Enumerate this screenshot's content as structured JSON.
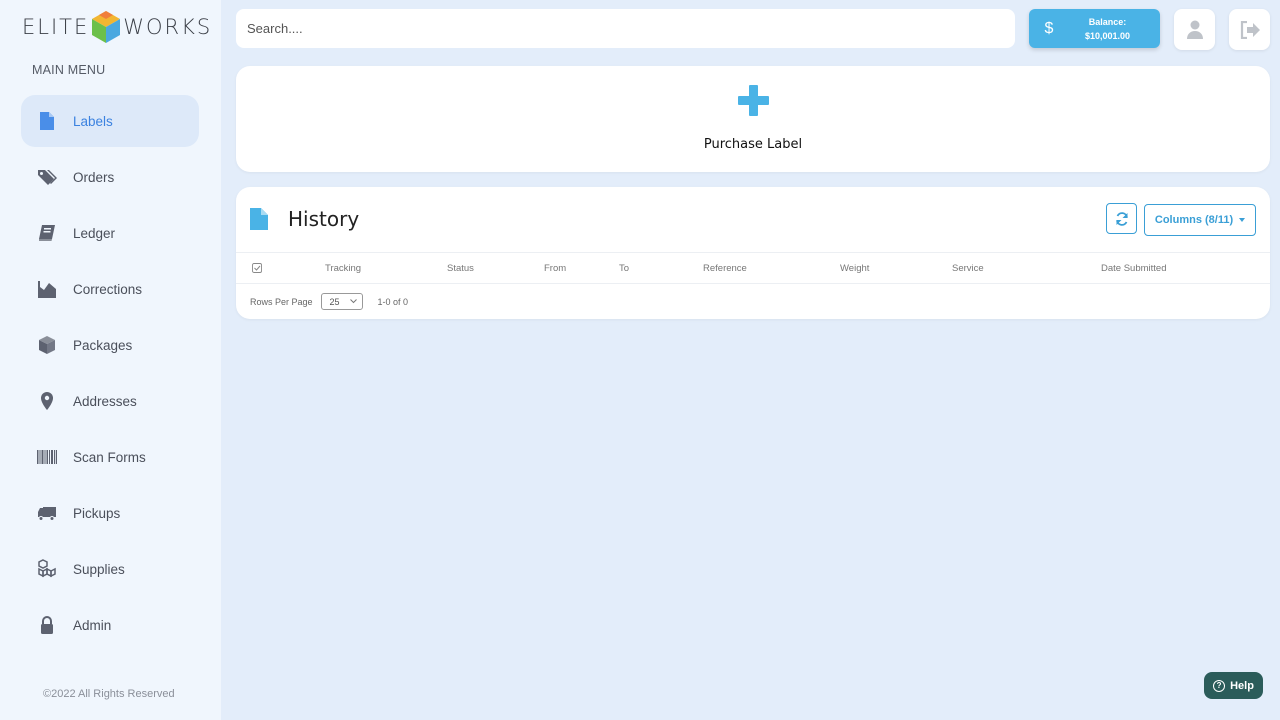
{
  "brand": {
    "left": "ELITE",
    "right": "WORKS"
  },
  "sidebar": {
    "menu_title": "MAIN MENU",
    "items": [
      {
        "label": "Labels",
        "icon": "file-icon",
        "active": true
      },
      {
        "label": "Orders",
        "icon": "tags-icon"
      },
      {
        "label": "Ledger",
        "icon": "book-icon"
      },
      {
        "label": "Corrections",
        "icon": "area-chart-icon"
      },
      {
        "label": "Packages",
        "icon": "cube-icon"
      },
      {
        "label": "Addresses",
        "icon": "map-marker-icon"
      },
      {
        "label": "Scan Forms",
        "icon": "barcode-icon"
      },
      {
        "label": "Pickups",
        "icon": "truck-icon"
      },
      {
        "label": "Supplies",
        "icon": "cubes-icon"
      },
      {
        "label": "Admin",
        "icon": "lock-icon"
      }
    ],
    "copyright": "©2022 All Rights Reserved"
  },
  "topbar": {
    "search_placeholder": "Search....",
    "balance_label": "Balance:",
    "balance_value": "$10,001.00",
    "currency_symbol": "$"
  },
  "purchase": {
    "label": "Purchase Label"
  },
  "history": {
    "title": "History",
    "columns_button": "Columns (8/11)",
    "headers": [
      "Tracking",
      "Status",
      "From",
      "To",
      "Reference",
      "Weight",
      "Service",
      "Date Submitted"
    ],
    "rows_per_page_label": "Rows Per Page",
    "rows_per_page_value": "25",
    "range_text": "1-0 of 0"
  },
  "help": {
    "label": "Help"
  },
  "colors": {
    "accent": "#4ab3e6",
    "active_text": "#3b82e0",
    "help_bg": "#2b5c5a",
    "page_bg": "#e3edfa"
  }
}
